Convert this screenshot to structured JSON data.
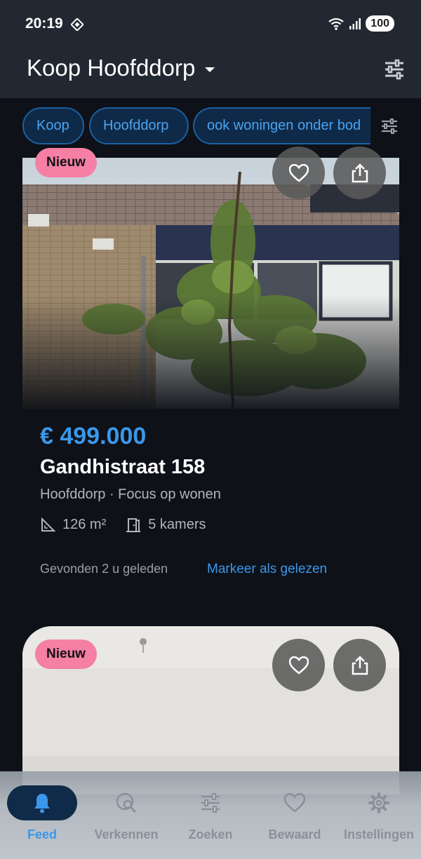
{
  "status_bar": {
    "time": "20:19",
    "battery": "100"
  },
  "app_bar": {
    "title": "Koop Hoofddorp"
  },
  "filter_chips": [
    "Koop",
    "Hoofddorp",
    "ook woningen onder bod"
  ],
  "listings": [
    {
      "badge": "Nieuw",
      "price": "€ 499.000",
      "street": "Gandhistraat 158",
      "place_agent": "Hoofddorp · Focus op wonen",
      "area": "126 m²",
      "rooms": "5 kamers",
      "found": "Gevonden 2 u geleden",
      "mark_read": "Markeer als gelezen"
    },
    {
      "badge": "Nieuw"
    }
  ],
  "bottom_nav": [
    {
      "label": "Feed",
      "icon": "bell-icon",
      "active": true
    },
    {
      "label": "Verkennen",
      "icon": "explore-icon",
      "active": false
    },
    {
      "label": "Zoeken",
      "icon": "tune-icon",
      "active": false
    },
    {
      "label": "Bewaard",
      "icon": "heart-icon",
      "active": false
    },
    {
      "label": "Instellingen",
      "icon": "gear-icon",
      "active": false
    }
  ],
  "colors": {
    "accent": "#3b97ea",
    "badge": "#f57fa5",
    "background": "#0e1117",
    "appbar": "#222831"
  }
}
